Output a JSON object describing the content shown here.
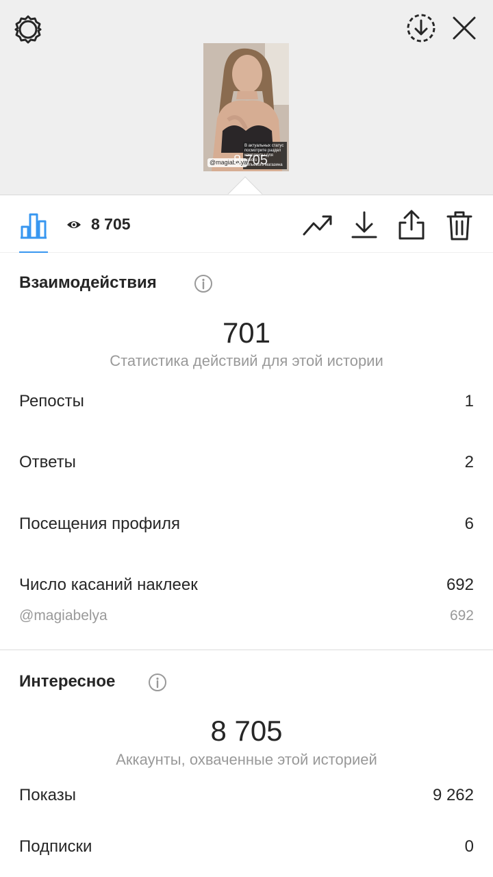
{
  "header": {
    "settings_icon": "settings-icon",
    "download_icon": "download-circle-icon",
    "close_icon": "close-icon",
    "thumbnail": {
      "caption_lines": [
        "В актуальных статус",
        "посмотрите раздел",
        "комплекты для нового",
        "бельевого магазина"
      ],
      "mention": "@magiabelya",
      "views_overlay": "8 705"
    }
  },
  "toolbar": {
    "views": "8 705",
    "accent": "#3897f0"
  },
  "interactions": {
    "title": "Взаимодействия",
    "total": "701",
    "subtitle": "Статистика действий для этой истории",
    "rows": [
      {
        "label": "Репосты",
        "value": "1"
      },
      {
        "label": "Ответы",
        "value": "2"
      },
      {
        "label": "Посещения профиля",
        "value": "6"
      },
      {
        "label": "Число касаний наклеек",
        "value": "692"
      }
    ],
    "sticker": {
      "label": "@magiabelya",
      "value": "692"
    }
  },
  "discovery": {
    "title": "Интересное",
    "total": "8 705",
    "subtitle": "Аккаунты, охваченные этой историей",
    "rows": [
      {
        "label": "Показы",
        "value": "9 262"
      },
      {
        "label": "Подписки",
        "value": "0"
      }
    ]
  }
}
